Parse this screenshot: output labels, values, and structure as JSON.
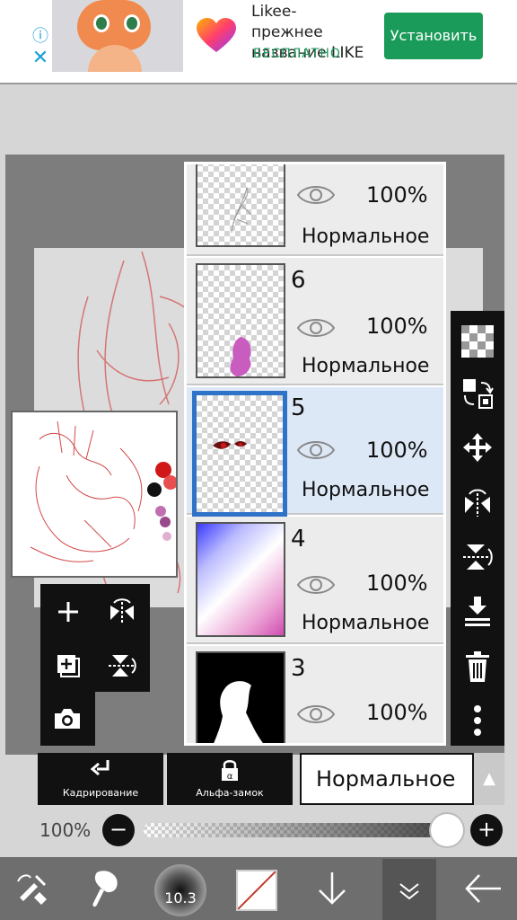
{
  "ad": {
    "info_icon": "info-icon",
    "close_icon": "close-icon",
    "title": "Likee-\nпрежнее\nназвание LIKE\nVid...",
    "title_short": "Likee-",
    "title_line2": "прежнее",
    "title_line3": "название LIKE",
    "subtitle": "БЕСПЛАТНО",
    "install_label": "Установить",
    "brand_color": "#1b9b5a"
  },
  "layers": [
    {
      "number": "",
      "opacity": "100%",
      "blend": "Нормальное",
      "selected": false
    },
    {
      "number": "6",
      "opacity": "100%",
      "blend": "Нормальное",
      "selected": false
    },
    {
      "number": "5",
      "opacity": "100%",
      "blend": "Нормальное",
      "selected": true
    },
    {
      "number": "4",
      "opacity": "100%",
      "blend": "Нормальное",
      "selected": false
    },
    {
      "number": "3",
      "opacity": "100%",
      "blend": "Нормальное",
      "selected": false
    }
  ],
  "controls": {
    "clipping_label": "Кадрирование",
    "alpha_lock_label": "Альфа-замок",
    "blend_mode": "Нормальное",
    "opacity_label": "100%",
    "opacity_value": 1.0
  },
  "bottom_bar": {
    "brush_size": "10.3"
  },
  "colors": {
    "selection": "#2f73c9",
    "panel_dark": "#111111",
    "selected_row": "#dde8f7"
  }
}
